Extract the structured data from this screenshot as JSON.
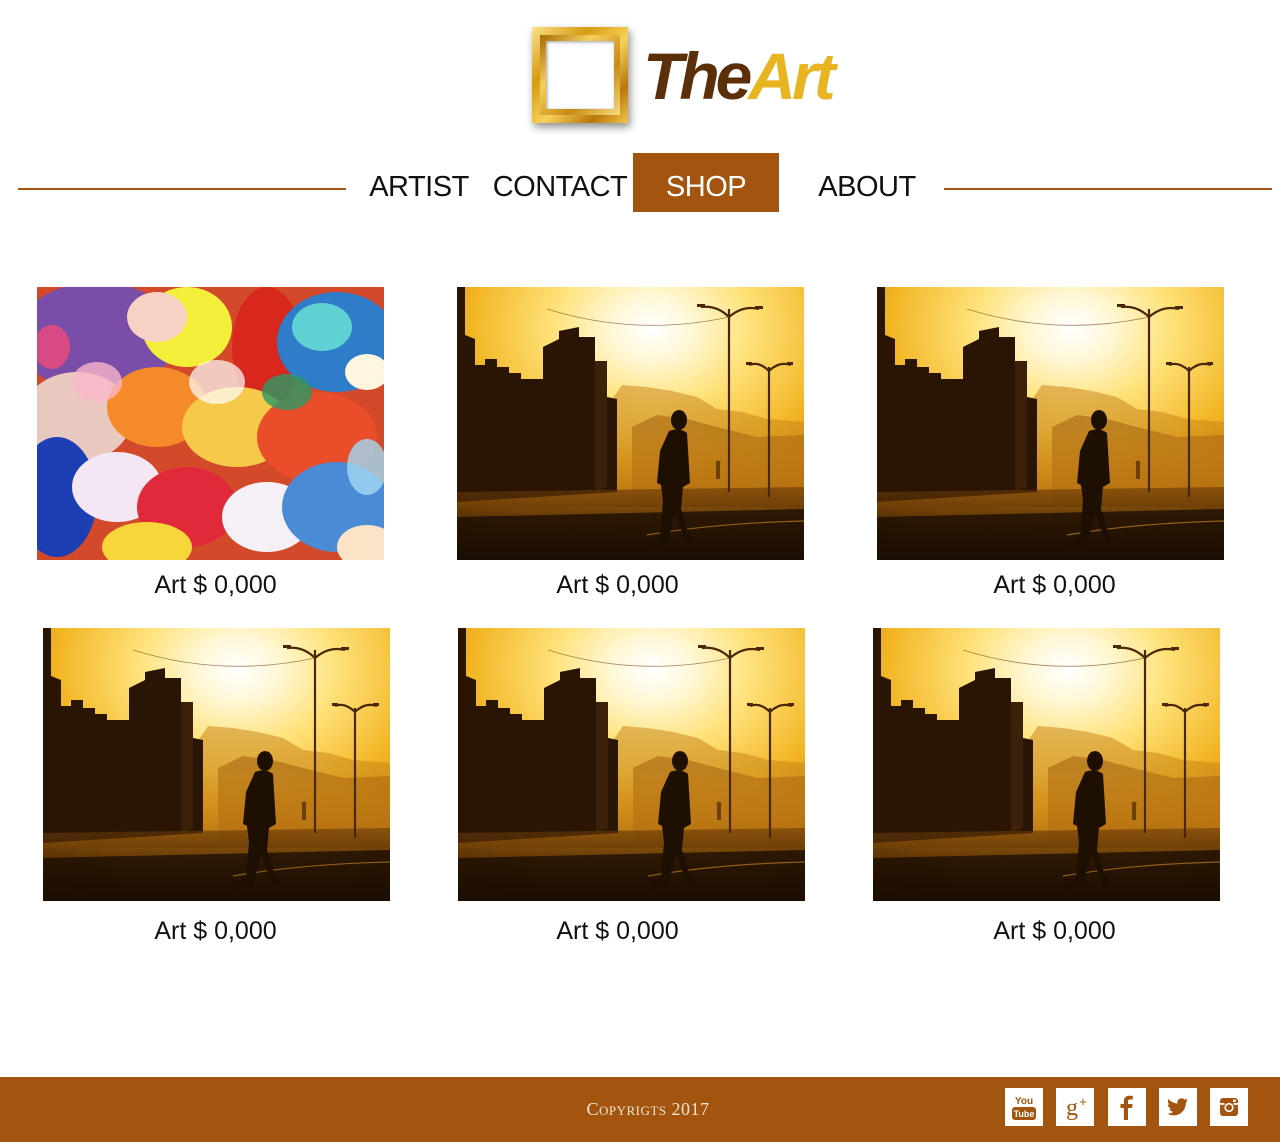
{
  "brand": {
    "name_part1": "The",
    "name_part2": "Art",
    "logo_icon": "gold-picture-frame-icon"
  },
  "nav": {
    "items": [
      {
        "label": "ARTIST",
        "active": false
      },
      {
        "label": "CONTACT",
        "active": false
      },
      {
        "label": "SHOP",
        "active": true
      },
      {
        "label": "ABOUT",
        "active": false
      }
    ]
  },
  "gallery": {
    "items": [
      {
        "caption": "Art $ 0,000",
        "image": "abstract-color-cloud"
      },
      {
        "caption": "Art $ 0,000",
        "image": "sunset-street-silhouette"
      },
      {
        "caption": "Art $ 0,000",
        "image": "sunset-street-silhouette"
      },
      {
        "caption": "Art $ 0,000",
        "image": "sunset-street-silhouette"
      },
      {
        "caption": "Art $ 0,000",
        "image": "sunset-street-silhouette"
      },
      {
        "caption": "Art $ 0,000",
        "image": "sunset-street-silhouette"
      }
    ]
  },
  "footer": {
    "copyright": "Copyrigts 2017",
    "social": [
      "youtube-icon",
      "google-plus-icon",
      "facebook-icon",
      "twitter-icon",
      "instagram-icon"
    ]
  },
  "colors": {
    "accent": "#a3540e",
    "logo_dark": "#5c2f0b",
    "logo_gold": "#e8b420"
  }
}
